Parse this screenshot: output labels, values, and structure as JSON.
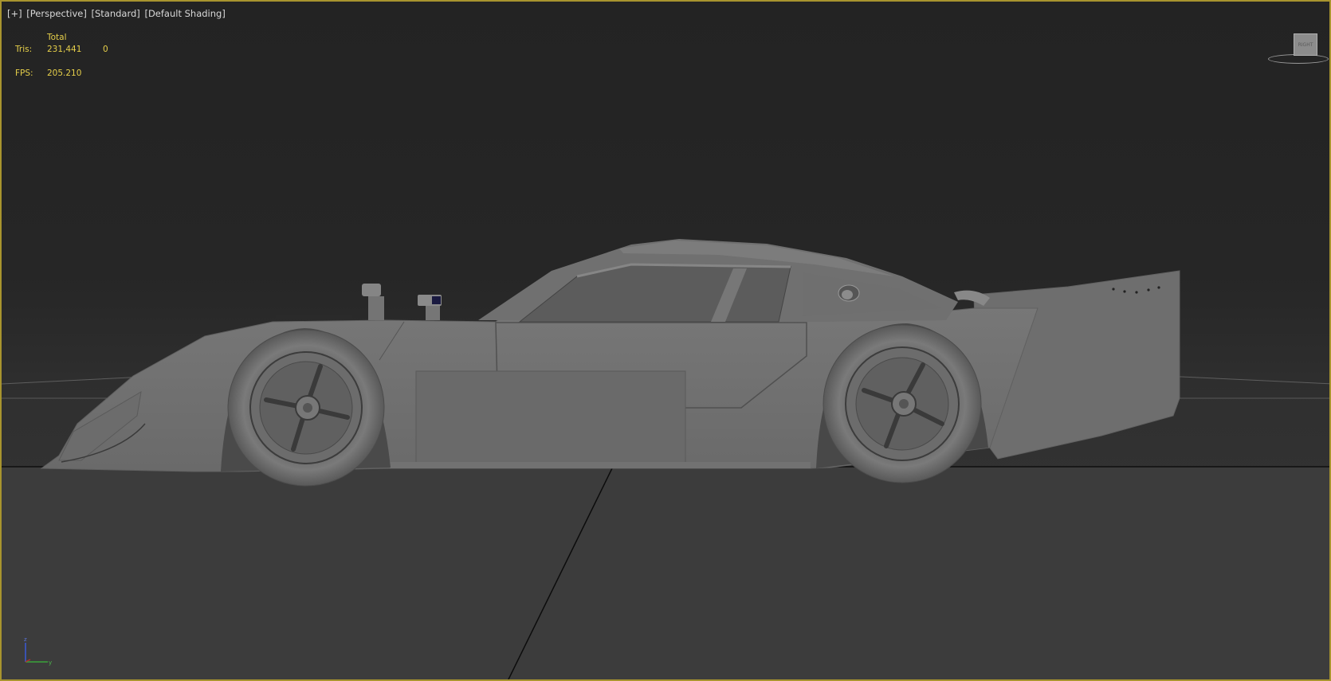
{
  "viewport_labels": {
    "plus": "[+]",
    "view": "[Perspective]",
    "preset": "[Standard]",
    "shading": "[Default Shading]"
  },
  "stats": {
    "header": "Total",
    "tris_label": "Tris:",
    "tris_total": "231,441",
    "tris_selected": "0",
    "fps_label": "FPS:",
    "fps_value": "205.210"
  },
  "viewcube": {
    "face_label": "RIGHT"
  },
  "axis_tripod": {
    "z": "z",
    "y": "y"
  },
  "colors": {
    "active_border": "#a8942e",
    "stats_text": "#e6cf4a",
    "menu_text": "#d8d8d8",
    "background_top": "#232323",
    "background_bottom": "#373737"
  }
}
